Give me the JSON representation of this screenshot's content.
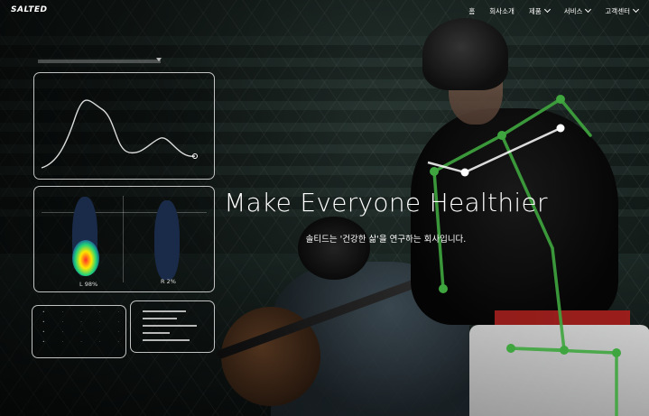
{
  "brand": {
    "logo": "SALTED"
  },
  "nav": {
    "items": [
      {
        "label": "홈",
        "has_dropdown": false
      },
      {
        "label": "회사소개",
        "has_dropdown": false
      },
      {
        "label": "제품",
        "has_dropdown": true
      },
      {
        "label": "서비스",
        "has_dropdown": true
      },
      {
        "label": "고객센터",
        "has_dropdown": true
      }
    ]
  },
  "hero": {
    "title": "Make Everyone Healthier",
    "subtitle": "솔티드는 '건강한 삶'을 연구하는 회사입니다."
  },
  "hud": {
    "left_foot_label": "L 98%",
    "right_foot_label": "R 2%"
  }
}
